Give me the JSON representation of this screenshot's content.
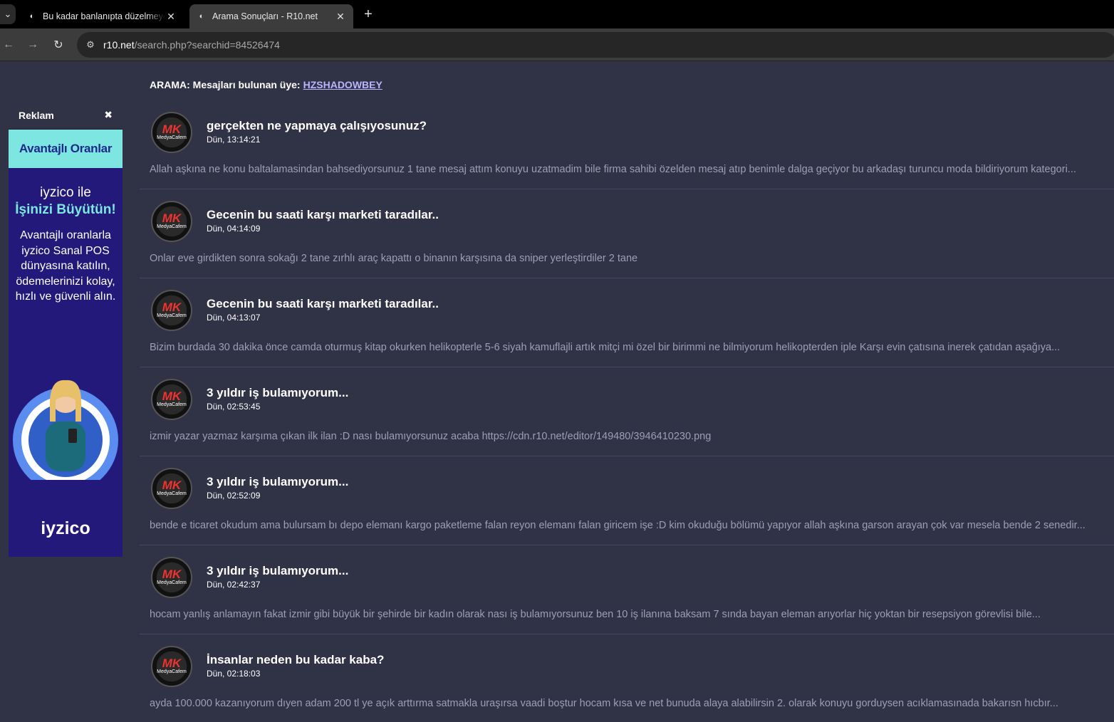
{
  "browser": {
    "tabs": [
      {
        "title": "Bu kadar banlanıpta düzelmeyen"
      },
      {
        "title": "Arama Sonuçları - R10.net"
      }
    ],
    "url_host": "r10.net",
    "url_path": "/search.php?searchid=84526474"
  },
  "ad": {
    "label": "Reklam",
    "banner": "Avantajlı Oranlar",
    "headline1": "iyzico ile",
    "headline2": "İşinizi Büyütün!",
    "body": "Avantajlı oranlarla iyzico Sanal POS dünyasına katılın, ödemelerinizi kolay, hızlı ve güvenli alın.",
    "brand": "iyzico"
  },
  "search": {
    "prefix": "ARAMA:",
    "text": "Mesajları bulunan üye:",
    "username": "HZSHADOWBEY"
  },
  "avatar": {
    "line1": "MK",
    "line2": "MedyaCafem"
  },
  "posts": [
    {
      "title": "gerçekten ne yapmaya çalışıyosunuz?",
      "date": "Dün, 13:14:21",
      "excerpt": "Allah aşkına ne konu baltalamasindan bahsediyorsunuz 1 tane mesaj attım konuyu uzatmadim bile firma sahibi özelden mesaj atıp benimle dalga geçiyor bu arkadaşı turuncu moda bildiriyorum kategori..."
    },
    {
      "title": "Gecenin bu saati karşı marketi taradılar..",
      "date": "Dün, 04:14:09",
      "excerpt": "Onlar eve girdikten sonra sokağı 2 tane zırhlı araç kapattı o binanın karşısına da sniper yerleştirdiler 2 tane"
    },
    {
      "title": "Gecenin bu saati karşı marketi taradılar..",
      "date": "Dün, 04:13:07",
      "excerpt": "Bizim burdada 30 dakika önce camda oturmuş kitap okurken helikopterle 5-6 siyah kamuflajli artık mitçi mi özel bir birimmi ne bilmiyorum helikopterden iple Karşı evin çatısına inerek çatıdan aşağıya..."
    },
    {
      "title": "3 yıldır iş bulamıyorum...",
      "date": "Dün, 02:53:45",
      "excerpt": "izmir yazar yazmaz karşıma çıkan ilk ilan :D nası bulamıyorsunuz acaba https://cdn.r10.net/editor/149480/3946410230.png"
    },
    {
      "title": "3 yıldır iş bulamıyorum...",
      "date": "Dün, 02:52:09",
      "excerpt": "bende e ticaret okudum ama bulursam bı depo elemanı kargo paketleme falan reyon elemanı falan giricem işe :D kim okuduğu bölümü yapıyor allah aşkına garson arayan çok var mesela bende 2 senedir..."
    },
    {
      "title": "3 yıldır iş bulamıyorum...",
      "date": "Dün, 02:42:37",
      "excerpt": "hocam yanlış anlamayın fakat izmir gibi büyük bir şehirde bir kadın olarak nası iş bulamıyorsunuz ben 10 iş ilanına baksam 7 sında bayan eleman arıyorlar hiç yoktan bir resepsiyon görevlisi bile..."
    },
    {
      "title": "İnsanlar neden bu kadar kaba?",
      "date": "Dün, 02:18:03",
      "excerpt": "ayda 100.000 kazanıyorum dıyen adam 200 tl ye açık arttırma satmakla uraşırsa vaadi boştur hocam kısa ve net bunuda alaya alabilirsin 2. olarak konuyu gorduysen acıklamasınada bakarısn hıcbır..."
    }
  ]
}
